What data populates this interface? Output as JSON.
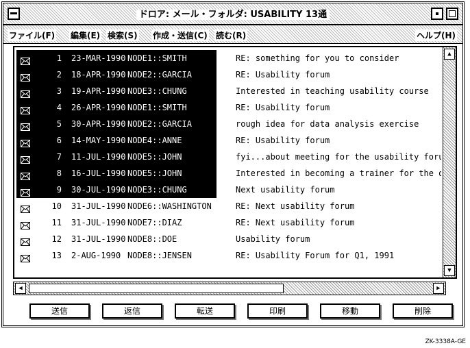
{
  "window": {
    "title": "ドロア: メール・フォルダ: USABILITY 13通"
  },
  "menubar": {
    "file": "ファイル(F)",
    "edit": "編集(E)",
    "search": "検索(S)",
    "compose": "作成・送信(C)",
    "read": "読む(R)",
    "help": "ヘルプ(H)"
  },
  "messages": [
    {
      "num": "1",
      "date": "23-MAR-1990",
      "from": "NODE1::SMITH",
      "subject": "RE: something for you to consider",
      "selected": true
    },
    {
      "num": "2",
      "date": "18-APR-1990",
      "from": "NODE2::GARCIA",
      "subject": "RE: Usability forum",
      "selected": true
    },
    {
      "num": "3",
      "date": "19-APR-1990",
      "from": "NODE3::CHUNG",
      "subject": "Interested in teaching usability course",
      "selected": true
    },
    {
      "num": "4",
      "date": "26-APR-1990",
      "from": "NODE1::SMITH",
      "subject": "RE: Usability forum",
      "selected": true
    },
    {
      "num": "5",
      "date": "30-APR-1990",
      "from": "NODE2::GARCIA",
      "subject": "rough idea for data analysis exercise",
      "selected": true
    },
    {
      "num": "6",
      "date": "14-MAY-1990",
      "from": "NODE4::ANNE",
      "subject": "RE: Usability forum",
      "selected": true
    },
    {
      "num": "7",
      "date": "11-JUL-1990",
      "from": "NODE5::JOHN",
      "subject": "fyi...about meeting for the usability foru",
      "selected": true
    },
    {
      "num": "8",
      "date": "16-JUL-1990",
      "from": "NODE5::JOHN",
      "subject": "Interested in becoming a trainer for the d",
      "selected": true
    },
    {
      "num": "9",
      "date": "30-JUL-1990",
      "from": "NODE3::CHUNG",
      "subject": "Next usability forum",
      "selected": true
    },
    {
      "num": "10",
      "date": "31-JUL-1990",
      "from": "NODE6::WASHINGTON",
      "subject": "RE: Next usability forum",
      "selected": false
    },
    {
      "num": "11",
      "date": "31-JUL-1990",
      "from": "NODE7::DIAZ",
      "subject": "RE: Next usability forum",
      "selected": false
    },
    {
      "num": "12",
      "date": "31-JUL-1990",
      "from": "NODE8::DOE",
      "subject": "Usability forum",
      "selected": false
    },
    {
      "num": "13",
      "date": "2-AUG-1990",
      "from": "NODE8::JENSEN",
      "subject": "RE: Usability Forum for Q1, 1991",
      "selected": false
    }
  ],
  "buttons": {
    "send": "送信",
    "reply": "返信",
    "forward": "転送",
    "print": "印刷",
    "move": "移動",
    "delete": "削除"
  },
  "caption": "ZK-3338A-GE",
  "icons": {
    "message": "envelope-icon",
    "up": "scroll-up-arrow-icon",
    "down": "scroll-down-arrow-icon",
    "left": "scroll-left-arrow-icon",
    "right": "scroll-right-arrow-icon"
  }
}
